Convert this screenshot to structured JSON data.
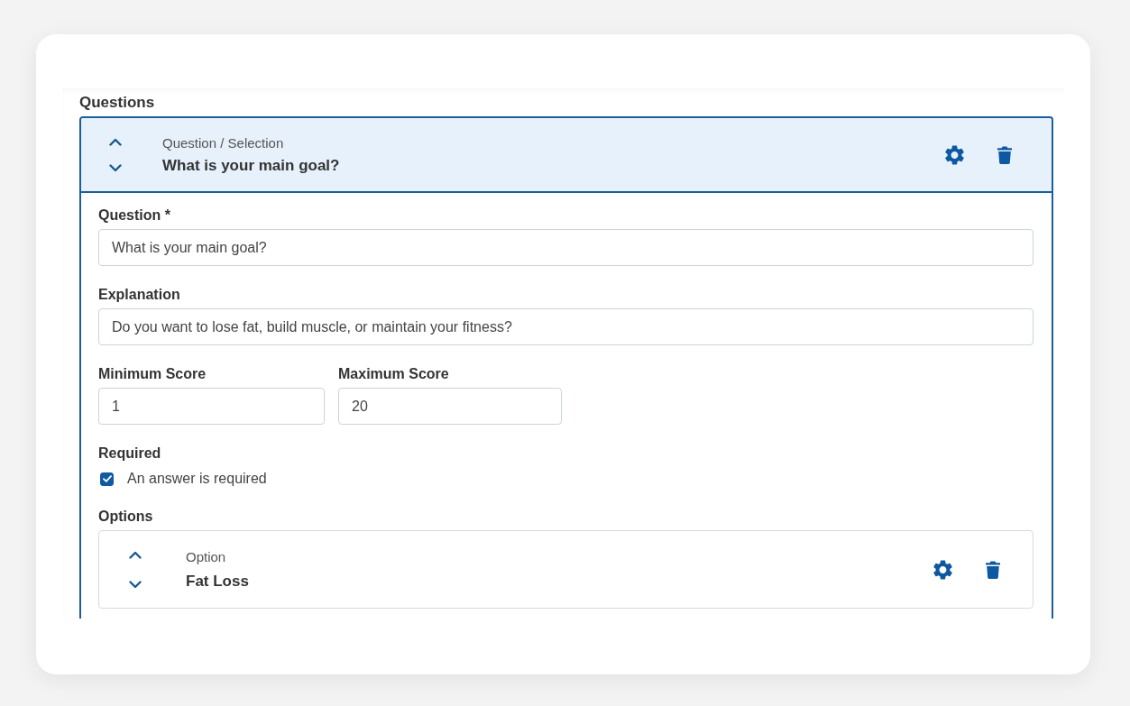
{
  "section_title": "Questions",
  "question": {
    "type_label": "Question / Selection",
    "title": "What is your main goal?",
    "expanded": true,
    "fields": [
      {
        "label": "Question *",
        "value": "What is your main goal?"
      },
      {
        "label": "Explanation",
        "value": "Do you want to lose fat, build muscle, or maintain your fitness?"
      }
    ],
    "score_fields": [
      {
        "label": "Minimum Score",
        "value": "1"
      },
      {
        "label": "Maximum Score",
        "value": "20"
      }
    ],
    "required": {
      "label": "Required",
      "checkbox_label": "An answer is required",
      "checked": true
    },
    "options": {
      "label": "Options",
      "items": [
        {
          "type_label": "Option",
          "title": "Fat Loss",
          "expanded": false
        }
      ]
    }
  }
}
